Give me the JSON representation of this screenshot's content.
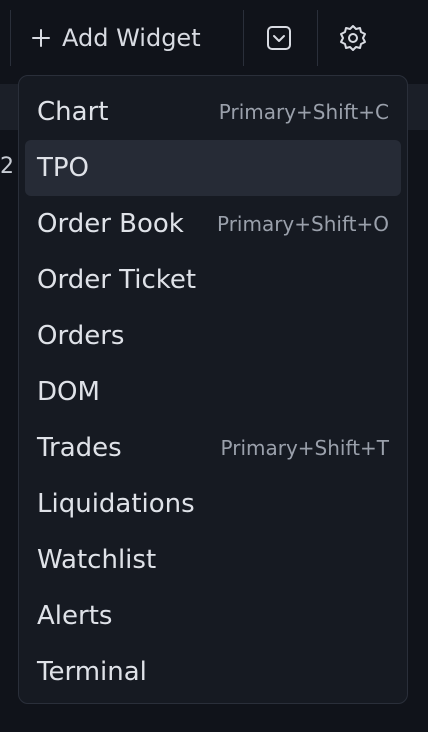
{
  "toolbar": {
    "add_widget_label": "Add Widget"
  },
  "background": {
    "edge_text": "2"
  },
  "menu": {
    "items": [
      {
        "label": "Chart",
        "shortcut": "Primary+Shift+C"
      },
      {
        "label": "TPO",
        "shortcut": ""
      },
      {
        "label": "Order Book",
        "shortcut": "Primary+Shift+O"
      },
      {
        "label": "Order Ticket",
        "shortcut": ""
      },
      {
        "label": "Orders",
        "shortcut": ""
      },
      {
        "label": "DOM",
        "shortcut": ""
      },
      {
        "label": "Trades",
        "shortcut": "Primary+Shift+T"
      },
      {
        "label": "Liquidations",
        "shortcut": ""
      },
      {
        "label": "Watchlist",
        "shortcut": ""
      },
      {
        "label": "Alerts",
        "shortcut": ""
      },
      {
        "label": "Terminal",
        "shortcut": ""
      }
    ],
    "active_index": 1
  },
  "colors": {
    "background": "#10131a",
    "menu_bg": "#161a22",
    "active_bg": "#262b36",
    "text": "#dfe2e8",
    "shortcut_text": "#9aa0ab"
  }
}
